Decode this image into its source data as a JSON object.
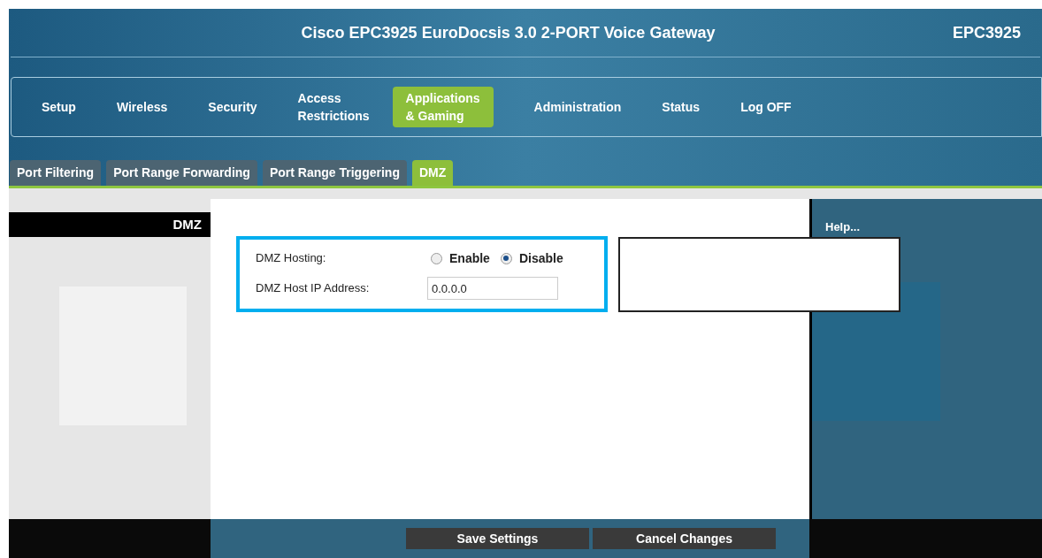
{
  "header": {
    "title": "Cisco EPC3925 EuroDocsis 3.0 2-PORT Voice Gateway",
    "model": "EPC3925"
  },
  "nav": [
    {
      "label": "Setup",
      "selected": false
    },
    {
      "label": "Wireless",
      "selected": false
    },
    {
      "label": "Security",
      "selected": false
    },
    {
      "label": "Access\nRestrictions",
      "selected": false
    },
    {
      "label": "Applications\n& Gaming",
      "selected": true
    },
    {
      "label": "Administration",
      "selected": false
    },
    {
      "label": "Status",
      "selected": false
    },
    {
      "label": "Log OFF",
      "selected": false
    }
  ],
  "subtabs": [
    {
      "label": "Port Filtering",
      "selected": false
    },
    {
      "label": "Port Range Forwarding",
      "selected": false
    },
    {
      "label": "Port Range Triggering",
      "selected": false
    },
    {
      "label": "DMZ",
      "selected": true
    }
  ],
  "sidebar": {
    "title": "DMZ"
  },
  "form": {
    "hosting_label": "DMZ Hosting:",
    "options": [
      {
        "label": "Enable",
        "selected": false
      },
      {
        "label": "Disable",
        "selected": true
      }
    ],
    "ip_label": "DMZ Host IP Address:",
    "ip_value": "0.0.0.0"
  },
  "help": {
    "link": "Help..."
  },
  "buttons": [
    "Save Settings",
    "Cancel Changes"
  ]
}
